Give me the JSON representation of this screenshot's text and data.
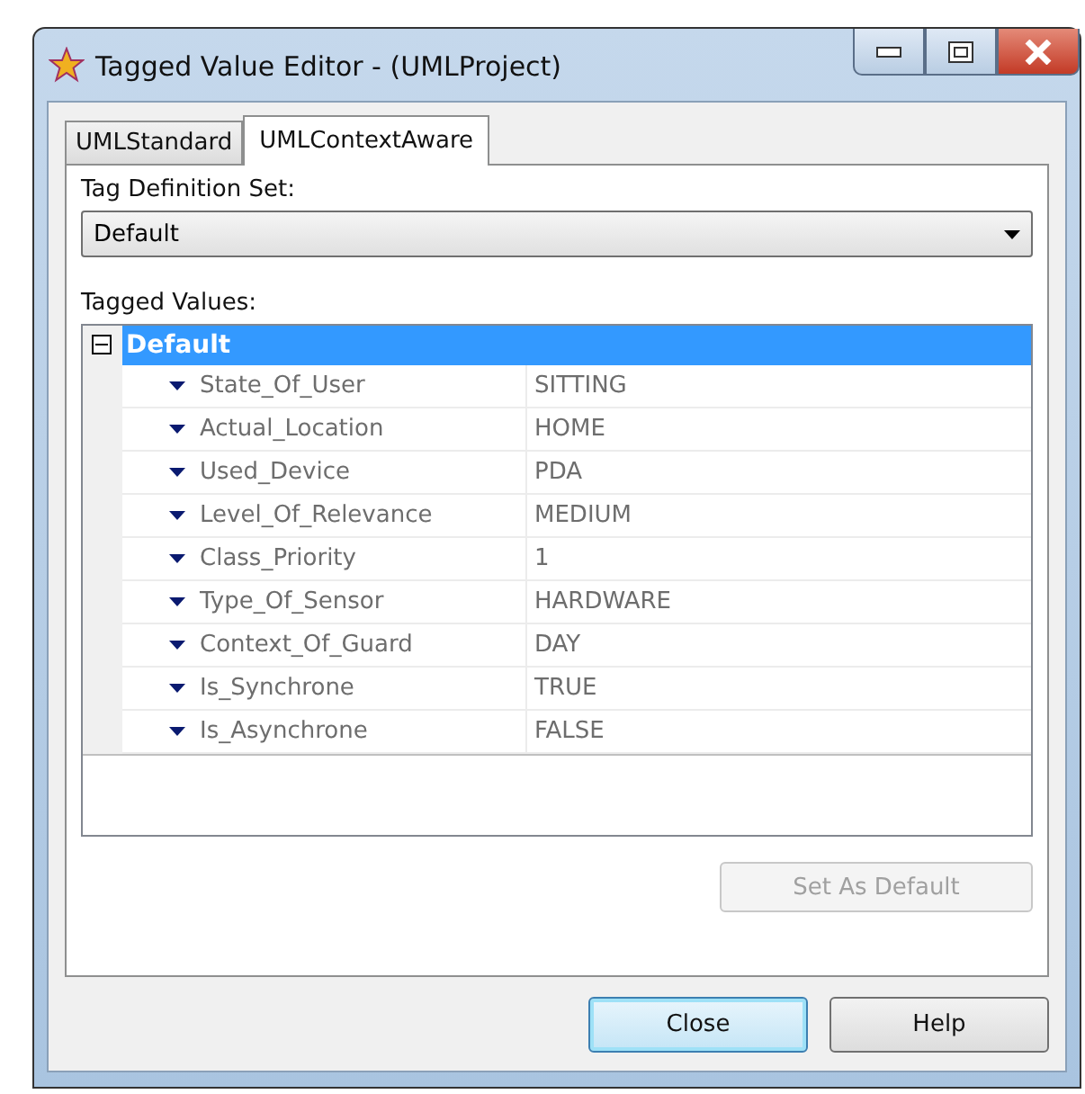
{
  "window": {
    "title": "Tagged Value Editor - (UMLProject)"
  },
  "tabs": [
    {
      "label": "UMLStandard",
      "selected": false
    },
    {
      "label": "UMLContextAware",
      "selected": true
    }
  ],
  "tag_definition_set": {
    "label": "Tag Definition Set:",
    "value": "Default"
  },
  "tagged_values": {
    "label": "Tagged Values:",
    "group": {
      "name": "Default",
      "expanded": true,
      "selected": true,
      "rows": [
        {
          "name": "State_Of_User",
          "value": "SITTING"
        },
        {
          "name": "Actual_Location",
          "value": "HOME"
        },
        {
          "name": "Used_Device",
          "value": "PDA"
        },
        {
          "name": "Level_Of_Relevance",
          "value": "MEDIUM"
        },
        {
          "name": "Class_Priority",
          "value": "1"
        },
        {
          "name": "Type_Of_Sensor",
          "value": "HARDWARE"
        },
        {
          "name": "Context_Of_Guard",
          "value": "DAY"
        },
        {
          "name": "Is_Synchrone",
          "value": "TRUE"
        },
        {
          "name": "Is_Asynchrone",
          "value": "FALSE"
        }
      ]
    }
  },
  "set_default_button": {
    "label": "Set As Default",
    "disabled": true
  },
  "buttons": [
    {
      "label": "Close",
      "selected": true
    },
    {
      "label": "Help",
      "selected": false
    }
  ]
}
